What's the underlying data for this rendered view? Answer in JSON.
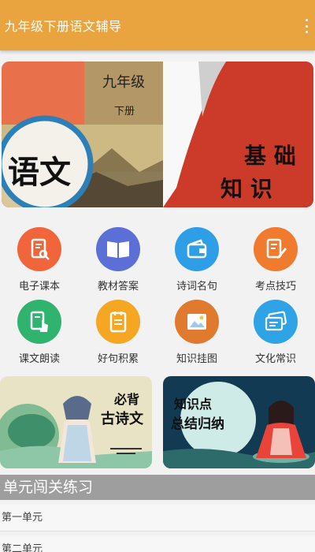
{
  "app": {
    "title": "九年级下册语文辅导"
  },
  "banner": {
    "book_grade": "九年级",
    "book_volume": "下册",
    "subject": "语文",
    "caption_line1": "基 础",
    "caption_line2": "知 识"
  },
  "grid": {
    "items": [
      {
        "label": "电子课本",
        "icon": "ebook-icon",
        "color": "#f0663a"
      },
      {
        "label": "教材答案",
        "icon": "open-book-icon",
        "color": "#5b6fd6"
      },
      {
        "label": "诗词名句",
        "icon": "wallet-icon",
        "color": "#2e9fe6"
      },
      {
        "label": "考点技巧",
        "icon": "edit-note-icon",
        "color": "#f07a2e"
      },
      {
        "label": "课文朗读",
        "icon": "touch-document-icon",
        "color": "#2fb36f"
      },
      {
        "label": "好句积累",
        "icon": "notes-icon",
        "color": "#f5a623"
      },
      {
        "label": "知识挂图",
        "icon": "picture-icon",
        "color": "#e07a2f"
      },
      {
        "label": "文化常识",
        "icon": "cards-icon",
        "color": "#2ea3e6"
      }
    ]
  },
  "cards": {
    "poems": {
      "line1": "必背",
      "line2": "古诗文"
    },
    "summary": {
      "line1": "知识点",
      "line2": "总结归纳"
    }
  },
  "section": {
    "title": "单元闯关练习"
  },
  "units": [
    "第一单元",
    "第二单元"
  ]
}
